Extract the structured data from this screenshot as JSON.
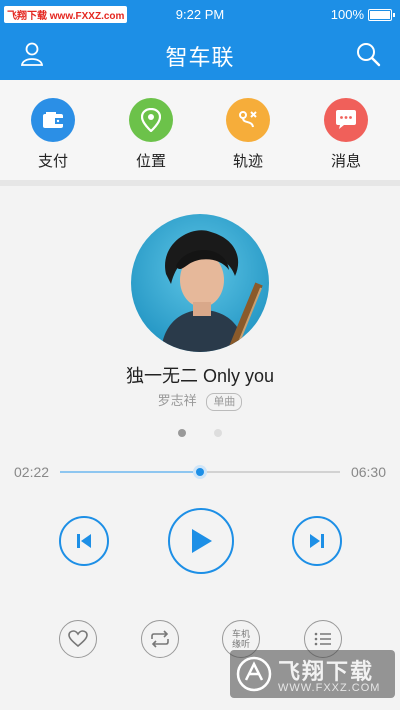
{
  "status_bar": {
    "carrier_label": "飞翔下载 www.FXXZ.com",
    "time": "9:22 PM",
    "battery": "100%"
  },
  "header": {
    "title": "智车联",
    "left_icon": "user-icon",
    "right_icon": "search-icon"
  },
  "shortcuts": [
    {
      "label": "支付",
      "icon": "wallet-icon",
      "color": "#2b8fe6"
    },
    {
      "label": "位置",
      "icon": "location-pin-icon",
      "color": "#6cc24a"
    },
    {
      "label": "轨迹",
      "icon": "track-icon",
      "color": "#f6ad3a"
    },
    {
      "label": "消息",
      "icon": "message-icon",
      "color": "#f0605a"
    }
  ],
  "player": {
    "song_title": "独一无二  Only you",
    "artist": "罗志祥",
    "tag": "单曲",
    "current_time": "02:22",
    "total_time": "06:30",
    "progress": 0.5,
    "page_count": 2,
    "active_page": 1
  },
  "bottom_controls": {
    "listen_line1": "车机",
    "listen_line2": "缘听"
  },
  "watermark": {
    "text": "飞翔下载",
    "url": "WWW.FXXZ.COM"
  },
  "colors": {
    "primary": "#1d8fe6",
    "background": "#f3f3f3"
  }
}
